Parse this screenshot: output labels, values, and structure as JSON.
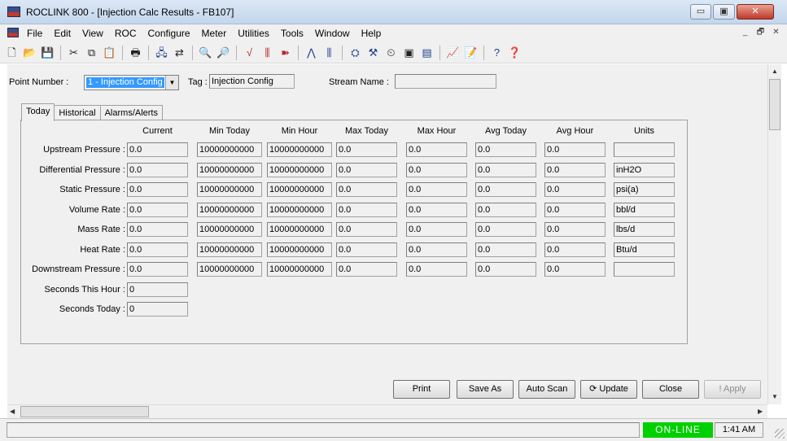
{
  "window": {
    "title": "ROCLINK 800 - [Injection Calc Results - FB107]",
    "minimize": "▭",
    "maximize": "▣",
    "close": "✕"
  },
  "menu": {
    "items": [
      "File",
      "Edit",
      "View",
      "ROC",
      "Configure",
      "Meter",
      "Utilities",
      "Tools",
      "Window",
      "Help"
    ],
    "mdi_minimize": "_",
    "mdi_restore": "🗗",
    "mdi_close": "✕"
  },
  "toolbar": {
    "icons": [
      {
        "name": "new-icon",
        "glyph": "🗋",
        "cls": ""
      },
      {
        "name": "open-icon",
        "glyph": "📂",
        "cls": ""
      },
      {
        "name": "save-icon",
        "glyph": "💾",
        "cls": ""
      },
      {
        "sep": true
      },
      {
        "name": "cut-icon",
        "glyph": "✂",
        "cls": ""
      },
      {
        "name": "copy-icon",
        "glyph": "⧉",
        "cls": ""
      },
      {
        "name": "paste-icon",
        "glyph": "📋",
        "cls": ""
      },
      {
        "sep": true
      },
      {
        "name": "print-icon",
        "glyph": "🖶",
        "cls": ""
      },
      {
        "sep": true
      },
      {
        "name": "connect-icon",
        "glyph": "🖧",
        "cls": "blue"
      },
      {
        "name": "direct-connect-icon",
        "glyph": "⇄",
        "cls": ""
      },
      {
        "sep": true
      },
      {
        "name": "zoom-in-icon",
        "glyph": "🔍",
        "cls": ""
      },
      {
        "name": "zoom-out-icon",
        "glyph": "🔎",
        "cls": ""
      },
      {
        "sep": true
      },
      {
        "name": "trend-icon",
        "glyph": "√",
        "cls": "red"
      },
      {
        "name": "bars-icon",
        "glyph": "⫼",
        "cls": "red"
      },
      {
        "name": "arrow-icon",
        "glyph": "➽",
        "cls": "red"
      },
      {
        "sep": true
      },
      {
        "name": "plot-icon",
        "glyph": "⋀",
        "cls": "blue"
      },
      {
        "name": "signal-icon",
        "glyph": "⫼",
        "cls": "blue"
      },
      {
        "sep": true
      },
      {
        "name": "flow-icon",
        "glyph": "⛭",
        "cls": "blue"
      },
      {
        "name": "tool-icon",
        "glyph": "⚒",
        "cls": "blue"
      },
      {
        "name": "clock-icon",
        "glyph": "⏲",
        "cls": ""
      },
      {
        "name": "display-icon",
        "glyph": "▣",
        "cls": ""
      },
      {
        "name": "display2-icon",
        "glyph": "▤",
        "cls": "blue"
      },
      {
        "sep": true
      },
      {
        "name": "chart-icon",
        "glyph": "📈",
        "cls": ""
      },
      {
        "name": "edit-doc-icon",
        "glyph": "📝",
        "cls": ""
      },
      {
        "sep": true
      },
      {
        "name": "help-icon",
        "glyph": "?",
        "cls": "blue"
      },
      {
        "name": "context-help-icon",
        "glyph": "❓",
        "cls": "blue"
      }
    ]
  },
  "header": {
    "point_label": "Point Number :",
    "point_value": "1 - Injection Config",
    "tag_label": "Tag :",
    "tag_value": "Injection Config",
    "stream_label": "Stream Name :",
    "stream_value": ""
  },
  "tabs": [
    "Today",
    "Historical",
    "Alarms/Alerts"
  ],
  "columns": [
    "Current",
    "Min Today",
    "Min Hour",
    "Max Today",
    "Max Hour",
    "Avg Today",
    "Avg Hour",
    "Units"
  ],
  "rows": [
    {
      "label": "Upstream Pressure :",
      "values": [
        "0.0",
        "10000000000",
        "10000000000",
        "0.0",
        "0.0",
        "0.0",
        "0.0",
        ""
      ]
    },
    {
      "label": "Differential Pressure :",
      "values": [
        "0.0",
        "10000000000",
        "10000000000",
        "0.0",
        "0.0",
        "0.0",
        "0.0",
        "inH2O"
      ]
    },
    {
      "label": "Static Pressure :",
      "values": [
        "0.0",
        "10000000000",
        "10000000000",
        "0.0",
        "0.0",
        "0.0",
        "0.0",
        "psi(a)"
      ]
    },
    {
      "label": "Volume Rate :",
      "values": [
        "0.0",
        "10000000000",
        "10000000000",
        "0.0",
        "0.0",
        "0.0",
        "0.0",
        "bbl/d"
      ]
    },
    {
      "label": "Mass Rate :",
      "values": [
        "0.0",
        "10000000000",
        "10000000000",
        "0.0",
        "0.0",
        "0.0",
        "0.0",
        "lbs/d"
      ]
    },
    {
      "label": "Heat Rate :",
      "values": [
        "0.0",
        "10000000000",
        "10000000000",
        "0.0",
        "0.0",
        "0.0",
        "0.0",
        "Btu/d"
      ]
    },
    {
      "label": "Downstream Pressure :",
      "values": [
        "0.0",
        "10000000000",
        "10000000000",
        "0.0",
        "0.0",
        "0.0",
        "0.0",
        ""
      ]
    }
  ],
  "extra_rows": [
    {
      "label": "Seconds This Hour :",
      "value": "0"
    },
    {
      "label": "Seconds Today :",
      "value": "0"
    }
  ],
  "buttons": {
    "print": "Print",
    "save_as": "Save As",
    "auto_scan": "Auto Scan",
    "update": "Update",
    "close": "Close",
    "apply": "Apply"
  },
  "status": {
    "message": "",
    "online": "ON-LINE",
    "time": "1:41 AM"
  },
  "colors": {
    "online": "#00d000",
    "selection": "#3399ff"
  }
}
